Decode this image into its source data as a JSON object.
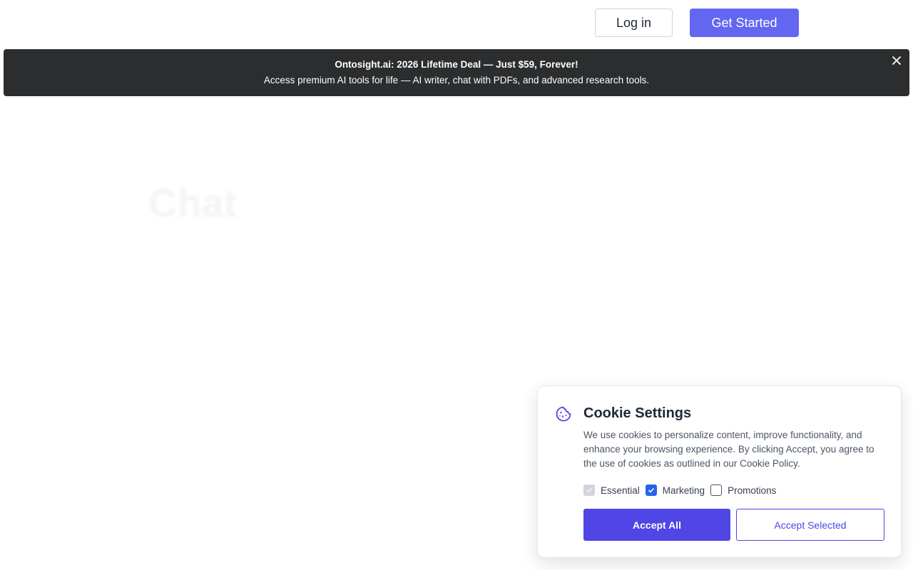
{
  "header": {
    "login_label": "Log in",
    "get_started_label": "Get Started"
  },
  "promo": {
    "title": "Ontosight.ai: 2026 Lifetime Deal — Just $59, Forever!",
    "subtitle": "Access premium AI tools for life — AI writer, chat with PDFs, and advanced research tools.",
    "close_icon": "close-icon"
  },
  "hero": {
    "ghost_heading": "Chat"
  },
  "cookie": {
    "icon": "cookie-icon",
    "title": "Cookie Settings",
    "text": "We use cookies to personalize content, improve functionality, and enhance your browsing experience. By clicking Accept, you agree to the use of cookies as outlined in our Cookie Policy.",
    "options": [
      {
        "label": "Essential",
        "checked": true,
        "disabled": true
      },
      {
        "label": "Marketing",
        "checked": true,
        "disabled": false
      },
      {
        "label": "Promotions",
        "checked": false,
        "disabled": false
      }
    ],
    "accept_all_label": "Accept All",
    "accept_selected_label": "Accept Selected"
  },
  "colors": {
    "primary": "#6366f1",
    "cookie_primary": "#4f46e5",
    "banner_bg": "#2b2d2f",
    "checkbox_blue": "#2563eb"
  }
}
